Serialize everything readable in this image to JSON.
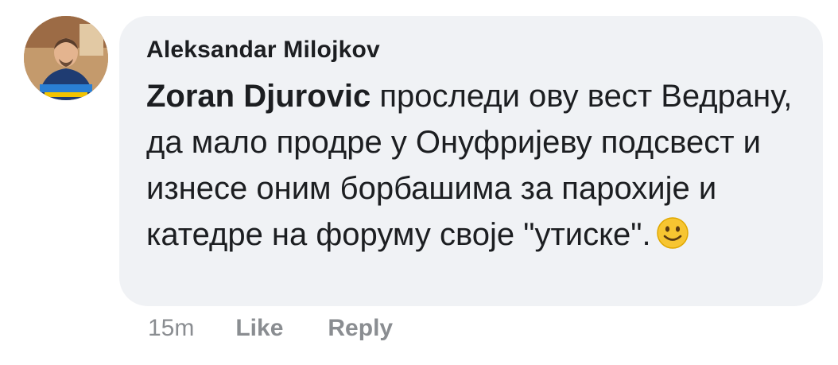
{
  "comment": {
    "author": "Aleksandar Milojkov",
    "mention": "Zoran Djurovic",
    "text": " проследи ову вест Ведрану, да мало продре у Онуфријеву подсвест и изнесе оним борбашима за парохије и катедре на форуму своје \"утиске\".",
    "emoji_icon": "slightly-smiling-face-icon",
    "timestamp": "15m",
    "like_label": "Like",
    "reply_label": "Reply"
  },
  "colors": {
    "bubble_bg": "#f0f2f5",
    "text": "#1c1e21",
    "meta": "#8a8d91",
    "emoji": "#f7c531"
  }
}
